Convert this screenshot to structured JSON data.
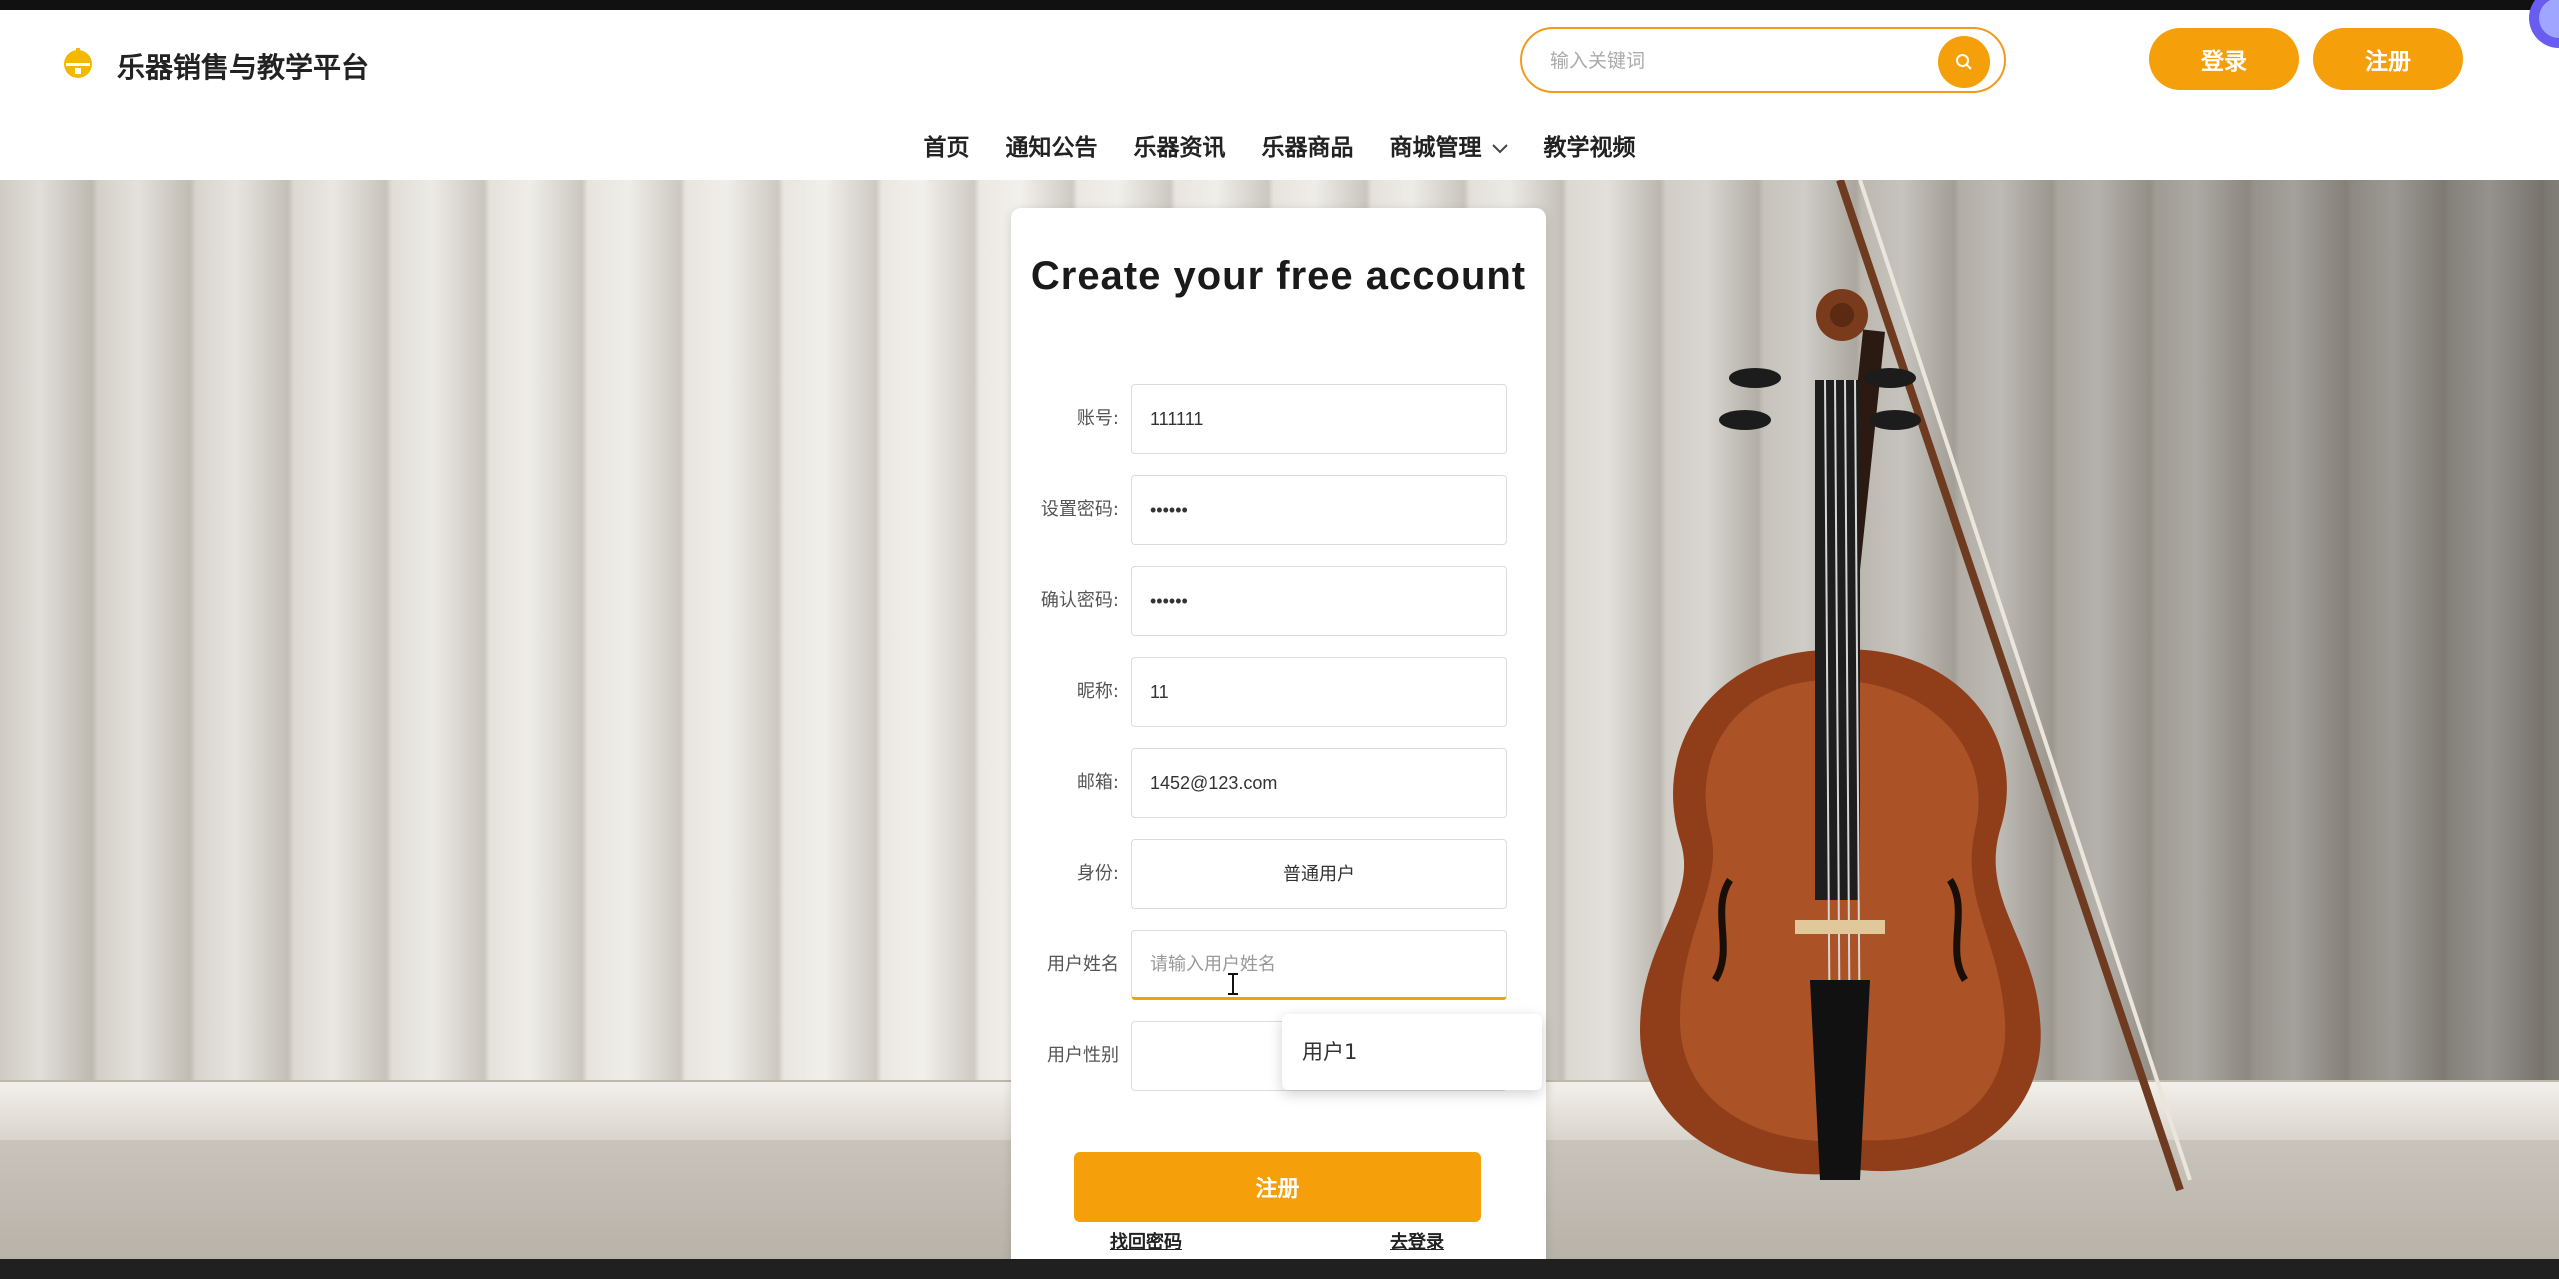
{
  "header": {
    "brand": "乐器销售与教学平台",
    "logo_icon": "bell-icon",
    "search": {
      "placeholder": "输入关键词",
      "value": "",
      "button_icon": "search-icon"
    },
    "login_label": "登录",
    "register_label": "注册"
  },
  "nav": {
    "items": [
      {
        "label": "首页"
      },
      {
        "label": "通知公告"
      },
      {
        "label": "乐器资讯"
      },
      {
        "label": "乐器商品"
      },
      {
        "label": "商城管理",
        "icon": "chevron-down-icon"
      },
      {
        "label": "教学视频"
      }
    ]
  },
  "form": {
    "title": "Create your free account",
    "fields": {
      "account": {
        "label": "账号:",
        "value": "111111"
      },
      "password": {
        "label": "设置密码:",
        "value": "••••••"
      },
      "confirm_password": {
        "label": "确认密码:",
        "value": "••••••"
      },
      "nickname": {
        "label": "昵称:",
        "value": "11"
      },
      "email": {
        "label": "邮箱:",
        "value": "1452@123.com"
      },
      "role": {
        "label": "身份:",
        "value": "普通用户"
      },
      "user_name": {
        "label": "用户姓名",
        "value": "",
        "placeholder": "请输入用户姓名"
      },
      "user_gender": {
        "label": "用户性别",
        "value": ""
      }
    },
    "autocomplete_option": "用户1",
    "submit_label": "注册",
    "forgot_link": "找回密码",
    "login_link": "去登录"
  },
  "theme": {
    "accent": "#f5a00a"
  }
}
